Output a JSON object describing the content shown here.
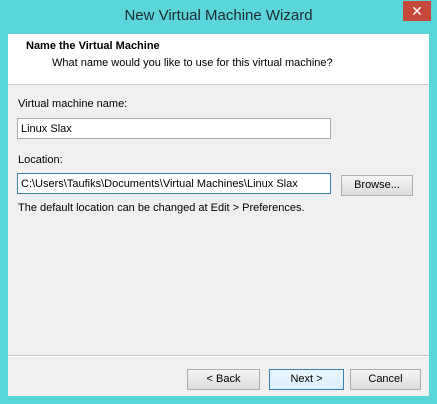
{
  "window": {
    "title": "New Virtual Machine Wizard",
    "close_glyph": "✕"
  },
  "header": {
    "title": "Name the Virtual Machine",
    "subtitle": "What name would you like to use for this virtual machine?"
  },
  "form": {
    "name_label": "Virtual machine name:",
    "name_value": "Linux Slax",
    "location_label": "Location:",
    "location_value": "C:\\Users\\Taufiks\\Documents\\Virtual Machines\\Linux Slax",
    "browse_label": "Browse...",
    "hint": "The default location can be changed at Edit > Preferences."
  },
  "footer": {
    "back_label": "< Back",
    "next_label": "Next >",
    "cancel_label": "Cancel"
  },
  "colors": {
    "title_bar": "#5ad6da",
    "close_button": "#c7473b",
    "focus_border": "#3c7fb1"
  }
}
